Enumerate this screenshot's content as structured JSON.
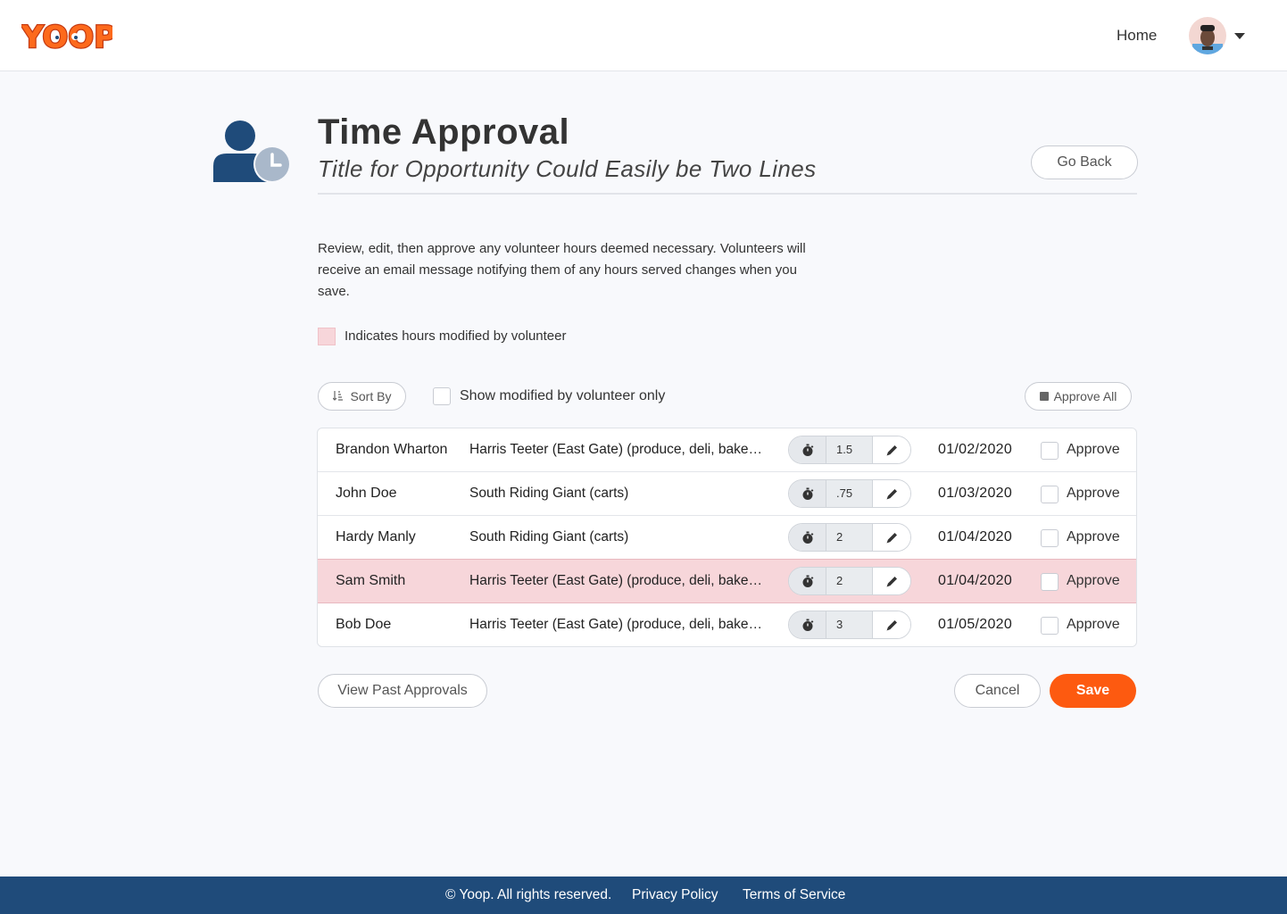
{
  "header": {
    "logo_text": "YOOP",
    "home_label": "Home"
  },
  "page": {
    "title": "Time Approval",
    "subtitle": "Title for Opportunity Could Easily be Two Lines",
    "go_back_label": "Go Back",
    "intro": "Review, edit, then approve any volunteer hours deemed necessary. Volunteers will receive an email message notifying them of any hours served changes when you save.",
    "legend_label": "Indicates hours modified by volunteer",
    "sort_label": "Sort By",
    "filter_label": "Show modified by volunteer only",
    "approve_all_label": "Approve All"
  },
  "rows": [
    {
      "name": "Brandon Wharton",
      "opportunity": "Harris Teeter (East Gate) (produce, deli, bakery, meat, seafood)",
      "hours": "1.5",
      "date": "01/02/2020",
      "approve_label": "Approve",
      "modified": false
    },
    {
      "name": "John Doe",
      "opportunity": "South Riding Giant (carts)",
      "hours": ".75",
      "date": "01/03/2020",
      "approve_label": "Approve",
      "modified": false
    },
    {
      "name": "Hardy Manly",
      "opportunity": "South Riding Giant (carts)",
      "hours": "2",
      "date": "01/04/2020",
      "approve_label": "Approve",
      "modified": false
    },
    {
      "name": "Sam Smith",
      "opportunity": "Harris Teeter (East Gate) (produce, deli, bakery, meat, seafood)",
      "hours": "2",
      "date": "01/04/2020",
      "approve_label": "Approve",
      "modified": true
    },
    {
      "name": "Bob Doe",
      "opportunity": "Harris Teeter (East Gate) (produce, deli, bakery, meat, seafood)",
      "hours": "3",
      "date": "01/05/2020",
      "approve_label": "Approve",
      "modified": false
    }
  ],
  "actions": {
    "past_label": "View Past Approvals",
    "cancel_label": "Cancel",
    "save_label": "Save"
  },
  "footer": {
    "copyright": "© Yoop. All rights reserved.",
    "privacy": "Privacy Policy",
    "terms": "Terms of Service"
  },
  "colors": {
    "accent": "#fd5a10",
    "footer": "#1f4b7a",
    "modified_row": "#f7d6da",
    "icon_blue": "#1f4b7a"
  }
}
